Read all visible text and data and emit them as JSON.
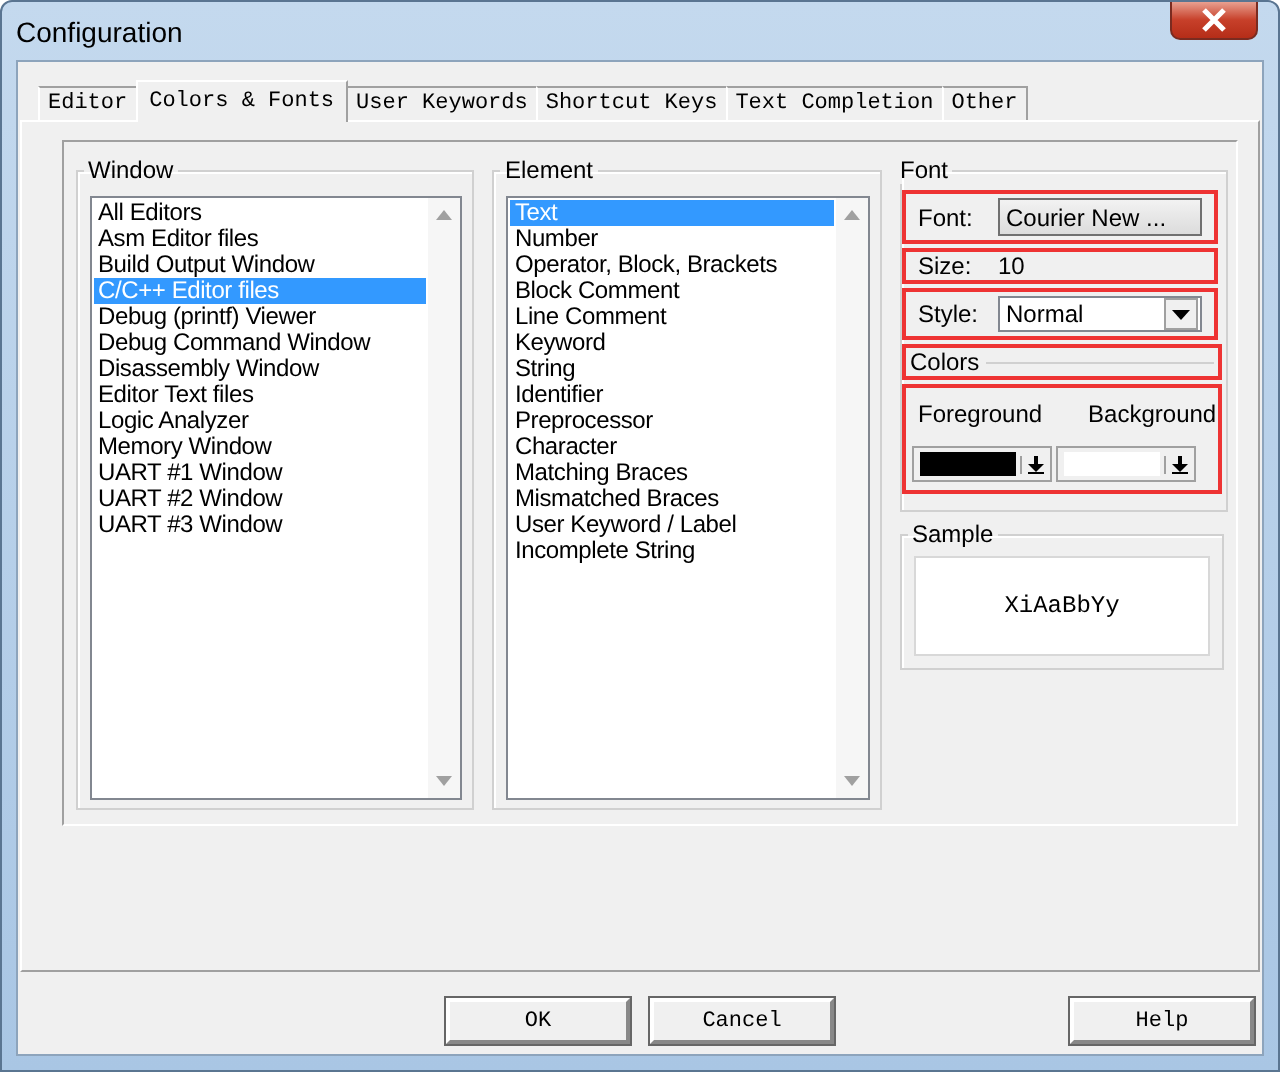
{
  "window": {
    "title": "Configuration"
  },
  "tabs": [
    {
      "label": "Editor",
      "selected": false
    },
    {
      "label": "Colors & Fonts",
      "selected": true
    },
    {
      "label": "User Keywords",
      "selected": false
    },
    {
      "label": "Shortcut Keys",
      "selected": false
    },
    {
      "label": "Text Completion",
      "selected": false
    },
    {
      "label": "Other",
      "selected": false
    }
  ],
  "window_list": {
    "label": "Window",
    "items": [
      {
        "label": "All Editors",
        "selected": false
      },
      {
        "label": "Asm Editor files",
        "selected": false
      },
      {
        "label": "Build Output Window",
        "selected": false
      },
      {
        "label": "C/C++ Editor files",
        "selected": true
      },
      {
        "label": "Debug (printf) Viewer",
        "selected": false
      },
      {
        "label": "Debug Command Window",
        "selected": false
      },
      {
        "label": "Disassembly Window",
        "selected": false
      },
      {
        "label": "Editor Text files",
        "selected": false
      },
      {
        "label": "Logic Analyzer",
        "selected": false
      },
      {
        "label": "Memory Window",
        "selected": false
      },
      {
        "label": "UART #1 Window",
        "selected": false
      },
      {
        "label": "UART #2 Window",
        "selected": false
      },
      {
        "label": "UART #3 Window",
        "selected": false
      }
    ]
  },
  "element_list": {
    "label": "Element",
    "items": [
      {
        "label": "Text",
        "selected": true
      },
      {
        "label": "Number",
        "selected": false
      },
      {
        "label": "Operator, Block, Brackets",
        "selected": false
      },
      {
        "label": "Block Comment",
        "selected": false
      },
      {
        "label": "Line Comment",
        "selected": false
      },
      {
        "label": "Keyword",
        "selected": false
      },
      {
        "label": "String",
        "selected": false
      },
      {
        "label": "Identifier",
        "selected": false
      },
      {
        "label": "Preprocessor",
        "selected": false
      },
      {
        "label": "Character",
        "selected": false
      },
      {
        "label": "Matching Braces",
        "selected": false
      },
      {
        "label": "Mismatched Braces",
        "selected": false
      },
      {
        "label": "User Keyword / Label",
        "selected": false
      },
      {
        "label": "Incomplete String",
        "selected": false
      }
    ]
  },
  "font": {
    "label": "Font",
    "rows": [
      {
        "kind": "button",
        "label": "Font:",
        "value": "Courier New ...",
        "highlighted": true
      },
      {
        "kind": "text",
        "label": "Size:",
        "value": "10",
        "highlighted": true
      },
      {
        "kind": "select",
        "label": "Style:",
        "value": "Normal",
        "highlighted": true
      }
    ]
  },
  "colors": {
    "label": "Colors",
    "label_highlighted": true,
    "highlighted": true,
    "swatches": [
      {
        "label": "Foreground",
        "color": "#000000"
      },
      {
        "label": "Background",
        "color": "#ffffff"
      }
    ]
  },
  "sample": {
    "label": "Sample",
    "text": "XiAaBbYy"
  },
  "buttons": [
    {
      "label": "OK"
    },
    {
      "label": "Cancel"
    },
    {
      "label": "Help"
    }
  ]
}
